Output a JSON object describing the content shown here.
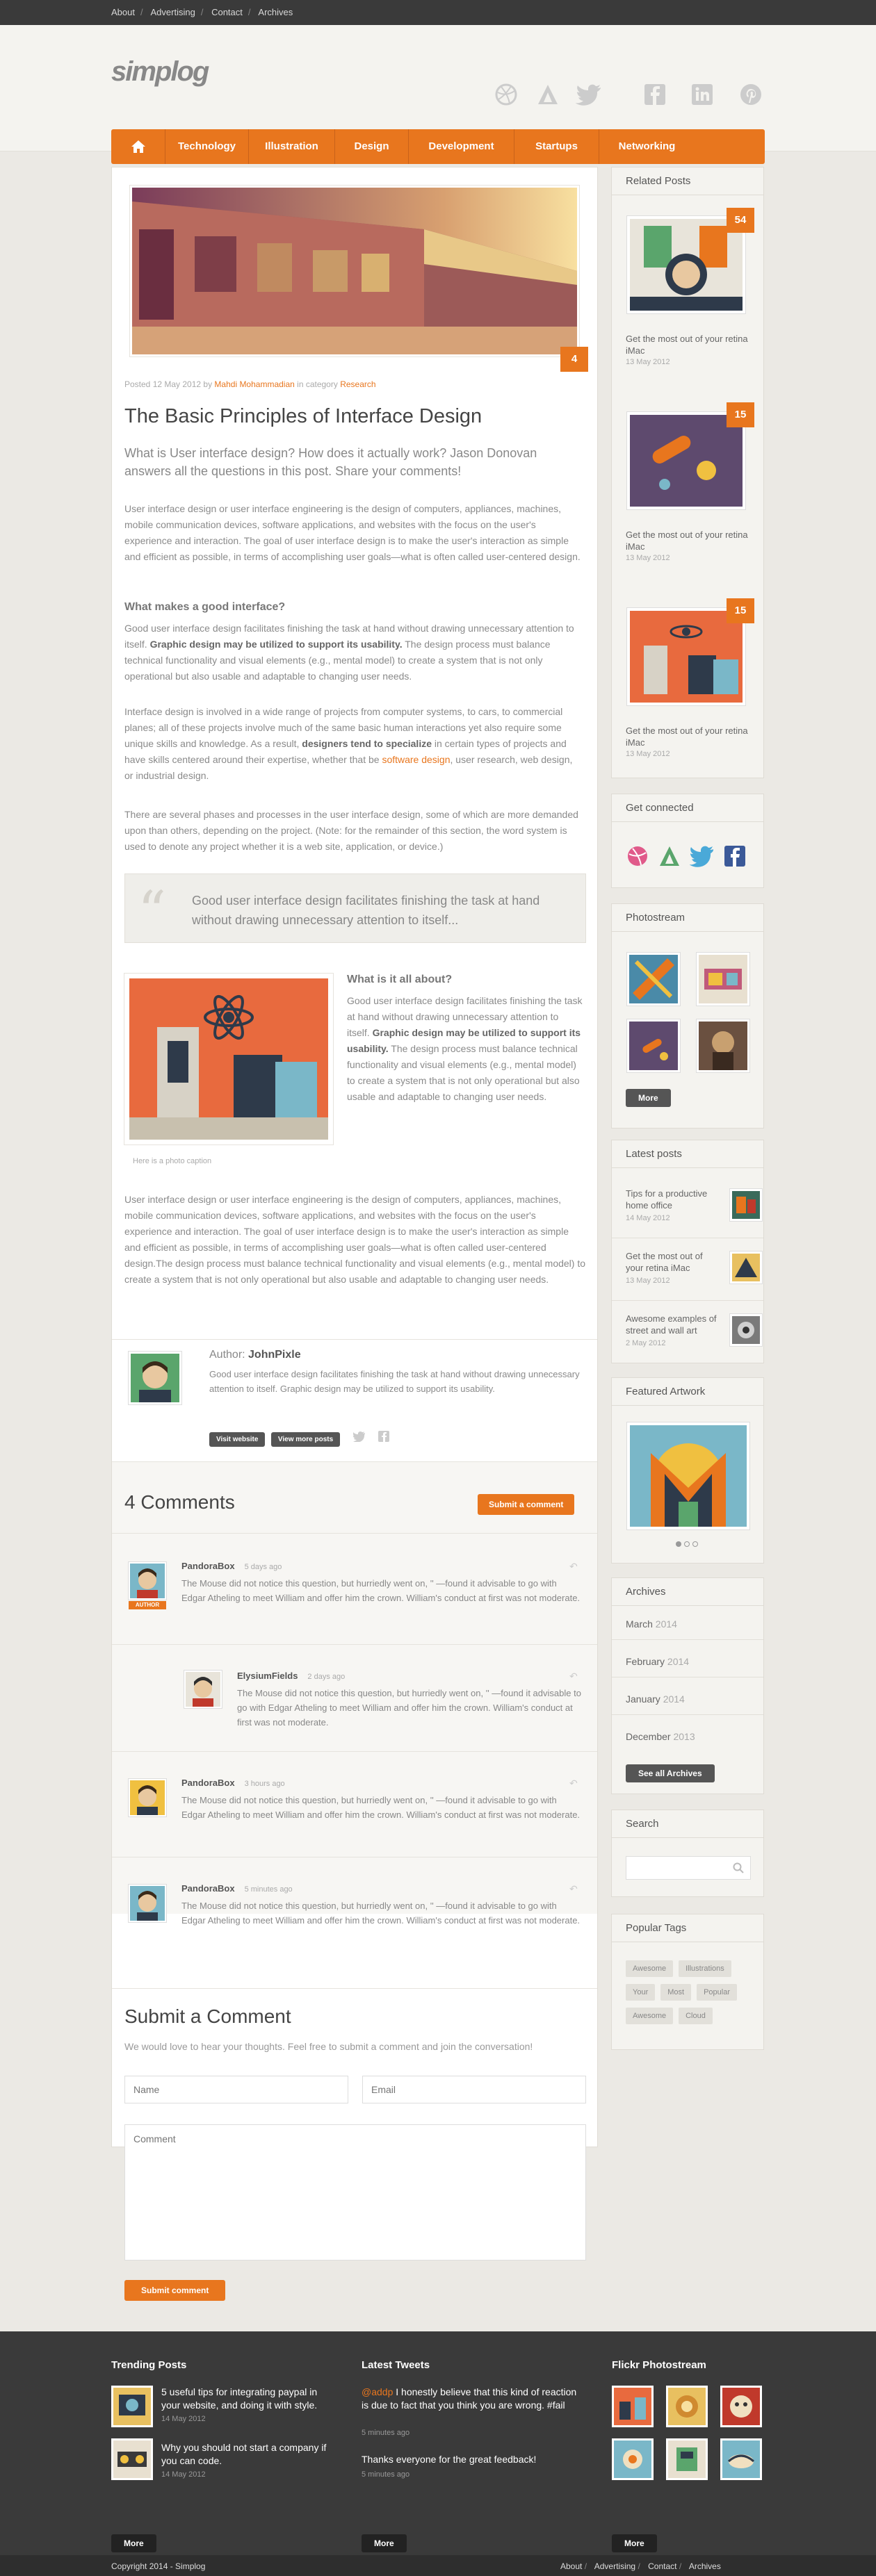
{
  "topbar": {
    "links": [
      "About",
      "Advertising",
      "Contact",
      "Archives"
    ]
  },
  "logo": "simplog",
  "social_top": [
    "dribbble-icon",
    "vimeo-icon",
    "twitter-icon",
    "facebook-icon",
    "linkedin-icon",
    "pinterest-icon"
  ],
  "nav": {
    "items": [
      "Technology",
      "Illustration",
      "Design",
      "Development",
      "Startups",
      "Networking"
    ]
  },
  "post": {
    "comment_count_badge": "4",
    "meta_prefix": "Posted 12 May 2012 by ",
    "author": "Mahdi Mohammadian",
    "meta_mid": " in category ",
    "category": "Research",
    "title": "The Basic Principles of Interface Design",
    "lead": "What is User interface design? How does it actually work? Jason Donovan answers all the questions in this post. Share your comments!",
    "p1": "User interface design or user interface engineering is the design of computers, appliances, machines, mobile communication devices, software applications, and websites with the focus on the user's experience and interaction. The goal of user interface design is to make the user's interaction as simple and efficient as possible, in terms of accomplishing user goals—what is often called user-centered design.",
    "h_good": "What makes a good interface?",
    "p2a": "Good user interface design facilitates finishing the task at hand without drawing unnecessary attention to itself. ",
    "p2b": "Graphic design may be utilized to support its usability.",
    "p2c": " The design process must balance technical functionality and visual elements (e.g., mental model) to create a system that is not only operational but also usable and adaptable to changing user needs.",
    "p3a": "Interface design is involved in a wide range of projects from computer systems, to cars, to commercial planes; all of these projects involve much of the same basic human interactions yet also require some unique skills and knowledge. As a result, ",
    "p3b": "designers tend to specialize",
    "p3c": " in certain types of projects and have skills centered around their expertise, whether that be ",
    "p3link": "software design",
    "p3d": ", user research, web design, or industrial design.",
    "p4": "There are several phases and processes in the user interface design, some of which are more demanded upon than others, depending on the project. (Note: for the remainder of this section, the word system is used to denote any project whether it is a web site, application, or device.)",
    "quote": "Good user interface design facilitates finishing the task at hand without drawing unnecessary attention to itself...",
    "h_about": "What is it all about?",
    "p5a": "Good user interface design facilitates finishing the task at hand without drawing unnecessary attention to itself. ",
    "p5b": "Graphic design may be utilized to support its usability.",
    "p5c": " The design process must balance technical functionality and visual elements (e.g., mental model) to create a system that is not only operational but also usable and adaptable to changing user needs.",
    "caption": "Here is a photo caption",
    "p6": "User interface design or user interface engineering is the design of computers, appliances, machines, mobile communication devices, software applications, and websites with the focus on the user's experience and interaction. The goal of user interface design is to make the user's interaction as simple and efficient as possible, in terms of accomplishing user goals—what is often called user-centered design.The design process must balance technical functionality and visual elements (e.g., mental model) to create a system that is not only operational but also usable and adaptable to changing user needs."
  },
  "author_box": {
    "label": "Author: ",
    "name": "JohnPixle",
    "bio": "Good user interface design facilitates finishing the task at hand without drawing unnecessary attention to itself. Graphic design may be utilized to support its usability.",
    "btn_website": "Visit website",
    "btn_posts": "View more posts"
  },
  "comments": {
    "heading": "4 Comments",
    "submit_btn": "Submit a comment",
    "items": [
      {
        "name": "PandoraBox",
        "time": "5 days ago",
        "author_badge": "AUTHOR",
        "text": "The Mouse did not notice this question, but hurriedly went on, '' —found it advisable to go with Edgar Atheling to meet William and offer him the crown. William's conduct at first was not moderate."
      },
      {
        "name": "ElysiumFields",
        "time": "2 days ago",
        "text": "The Mouse did not notice this question, but hurriedly went on, '' —found it advisable to go with Edgar Atheling to meet William and offer him the crown. William's conduct at first was not moderate."
      },
      {
        "name": "PandoraBox",
        "time": "3 hours ago",
        "text": "The Mouse did not notice this question, but hurriedly went on, '' —found it advisable to go with Edgar Atheling to meet William and offer him the crown. William's conduct at first was not moderate."
      },
      {
        "name": "PandoraBox",
        "time": "5 minutes ago",
        "text": "The Mouse did not notice this question, but hurriedly went on, '' —found it advisable to go with Edgar Atheling to meet William and offer him the crown. William's conduct at first was not moderate."
      }
    ]
  },
  "form": {
    "title": "Submit a Comment",
    "intro": "We would love to hear your thoughts. Feel free to submit a comment and join the conversation!",
    "name_ph": "Name",
    "email_ph": "Email",
    "comment_ph": "Comment",
    "submit": "Submit comment"
  },
  "sidebar": {
    "related": {
      "title": "Related Posts",
      "items": [
        {
          "badge": "54",
          "title": "Get the most out of your retina iMac",
          "date": "13 May 2012"
        },
        {
          "badge": "15",
          "title": "Get the most out of your retina iMac",
          "date": "13 May 2012"
        },
        {
          "badge": "15",
          "title": "Get the most out of your retina iMac",
          "date": "13 May 2012"
        }
      ]
    },
    "connected": {
      "title": "Get connected"
    },
    "photostream": {
      "title": "Photostream",
      "more": "More"
    },
    "latest": {
      "title": "Latest posts",
      "items": [
        {
          "title": "Tips for a productive home office",
          "date": "14 May 2012"
        },
        {
          "title": "Get the most out of your retina iMac",
          "date": "13 May 2012"
        },
        {
          "title": "Awesome examples of street and wall art",
          "date": "2 May 2012"
        }
      ]
    },
    "featured": {
      "title": "Featured Artwork"
    },
    "archives": {
      "title": "Archives",
      "items": [
        {
          "month": "March",
          "year": "2014"
        },
        {
          "month": "February",
          "year": "2014"
        },
        {
          "month": "January",
          "year": "2014"
        },
        {
          "month": "December",
          "year": "2013"
        }
      ],
      "btn": "See all Archives"
    },
    "search": {
      "title": "Search"
    },
    "tags": {
      "title": "Popular Tags",
      "items": [
        "Awesome",
        "Illustrations",
        "Your",
        "Most",
        "Popular",
        "Awesome",
        "Cloud"
      ]
    }
  },
  "footer": {
    "trending": {
      "title": "Trending Posts",
      "items": [
        {
          "title": "5 useful tips for integrating paypal in your website, and doing it with style.",
          "date": "14 May 2012"
        },
        {
          "title": "Why you should not start a company if you can code.",
          "date": "14 May 2012"
        }
      ],
      "more": "More"
    },
    "tweets": {
      "title": "Latest Tweets",
      "items": [
        {
          "handle": "@addp",
          "text": " I honestly believe that this kind of reaction is due to fact that you think you are wrong. #fail",
          "time": "5 minutes ago"
        },
        {
          "text": "Thanks everyone for the great feedback!",
          "time": "5 minutes ago"
        }
      ],
      "more": "More"
    },
    "flickr": {
      "title": "Flickr Photostream",
      "more": "More"
    },
    "copyright": "Copyright 2014 - Simplog",
    "links": [
      "About",
      "Advertising",
      "Contact",
      "Archives"
    ]
  }
}
